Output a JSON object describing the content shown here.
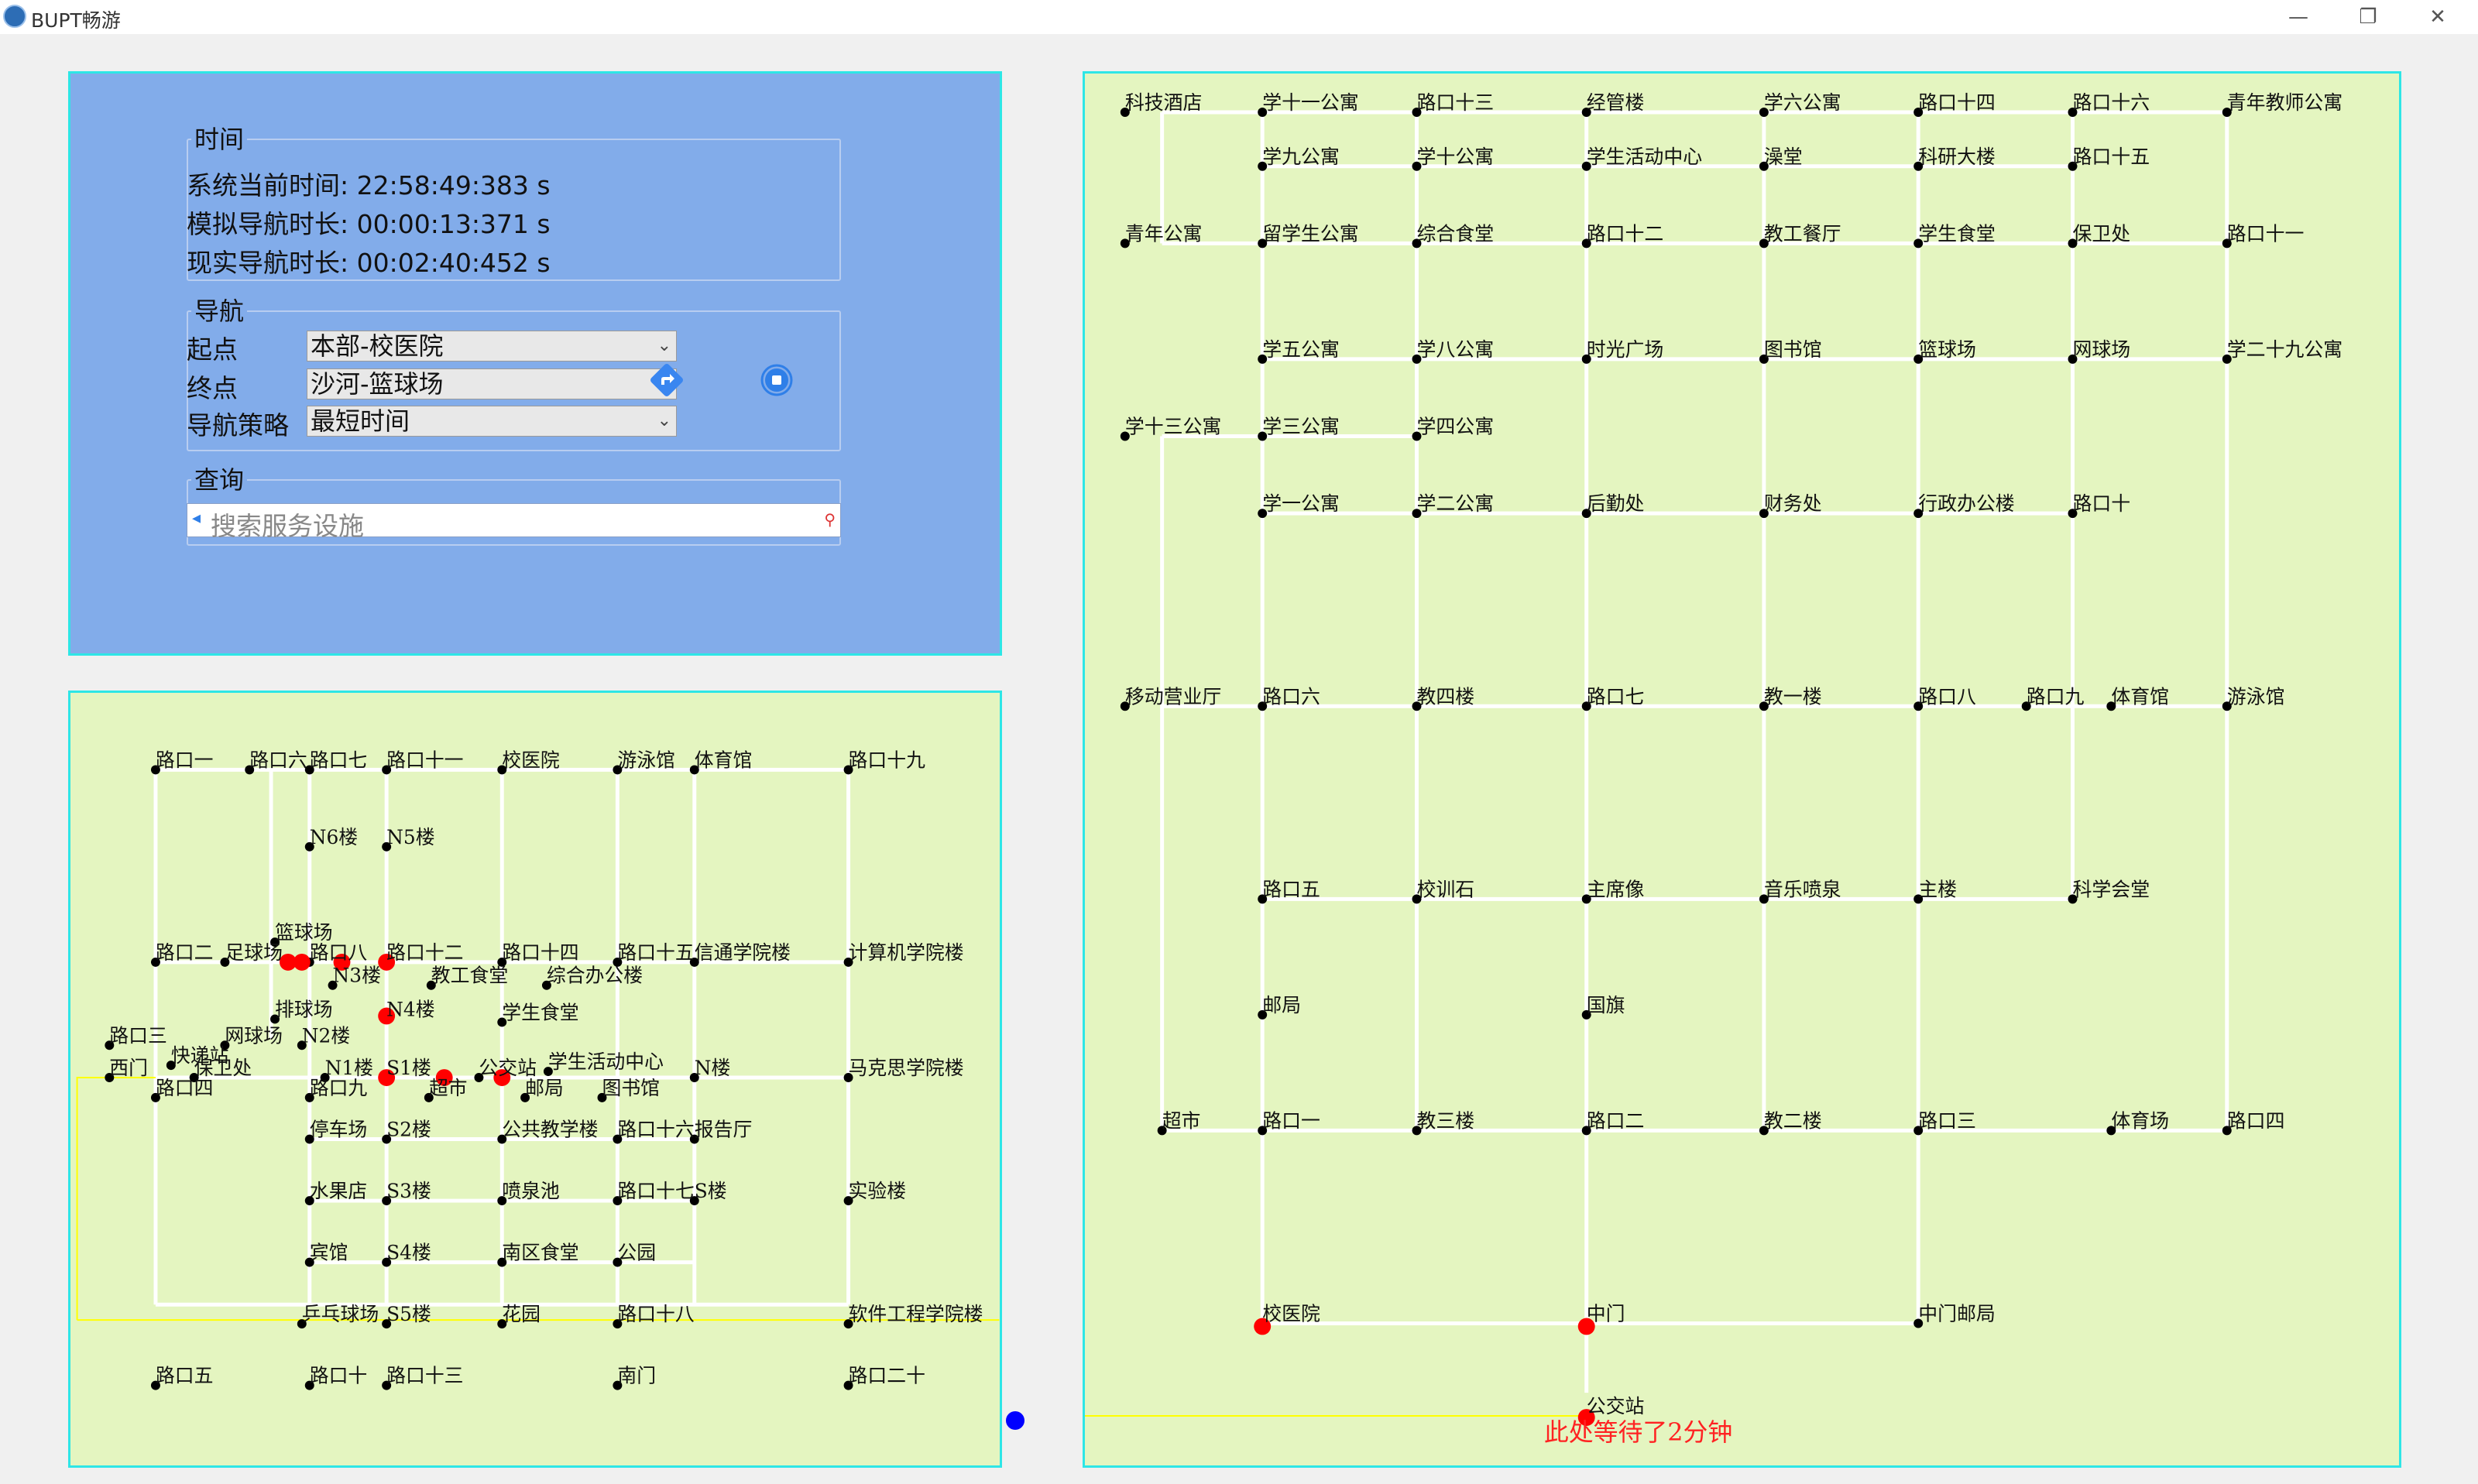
{
  "window": {
    "title": "BUPT畅游",
    "minimize_glyph": "—",
    "restore_glyph": "❐",
    "close_glyph": "✕"
  },
  "time_group": {
    "title": "时间",
    "system_time_label": "系统当前时间: 22:58:49:383 s",
    "sim_nav_label": "模拟导航时长: 00:00:13:371 s",
    "real_nav_label": "现实导航时长: 00:02:40:452 s"
  },
  "nav_group": {
    "title": "导航",
    "start_label": "起点",
    "start_value": "本部-校医院",
    "end_label": "终点",
    "end_value": "沙河-篮球场",
    "strategy_label": "导航策略",
    "strategy_value": "最短时间",
    "go_icon": "navigate-icon",
    "stop_icon": "stop-icon"
  },
  "query_group": {
    "title": "查询",
    "placeholder": "搜索服务设施"
  },
  "colors": {
    "panel_blue": "#82acea",
    "map_bg": "#e4f5c0",
    "road": "#ffffff",
    "path": "#ffff00",
    "path_node": "#ff0000",
    "current_pos": "#0000ff",
    "border": "#2ee6e6"
  },
  "left_map": {
    "labels": [
      "路口一",
      "路口六",
      "路口七",
      "路口十一",
      "校医院",
      "游泳馆",
      "体育馆",
      "路口十九",
      "N6楼",
      "N5楼",
      "篮球场",
      "路口二",
      "足球场",
      "路口八",
      "路口十二",
      "路口十四",
      "路口十五",
      "信通学院楼",
      "计算机学院楼",
      "N3楼",
      "教工食堂",
      "综合办公楼",
      "排球场",
      "N4楼",
      "学生食堂",
      "路口三",
      "网球场",
      "N2楼",
      "快递站",
      "西门",
      "保卫处",
      "N1楼",
      "S1楼",
      "公交站",
      "学生活动中心",
      "N楼",
      "马克思学院楼",
      "路口四",
      "路口九",
      "超市",
      "邮局",
      "图书馆",
      "停车场",
      "S2楼",
      "公共教学楼",
      "路口十六",
      "报告厅",
      "水果店",
      "S3楼",
      "喷泉池",
      "路口十七",
      "S楼",
      "实验楼",
      "宾馆",
      "S4楼",
      "南区食堂",
      "公园",
      "乒乓球场",
      "S5楼",
      "花园",
      "路口十八",
      "软件工程学院楼",
      "路口五",
      "路口十",
      "路口十三",
      "南门",
      "路口二十"
    ]
  },
  "right_map": {
    "labels": [
      "科技酒店",
      "学十一公寓",
      "路口十三",
      "经管楼",
      "学六公寓",
      "路口十四",
      "路口十六",
      "青年教师公寓",
      "学九公寓",
      "学十公寓",
      "学生活动中心",
      "澡堂",
      "科研大楼",
      "路口十五",
      "青年公寓",
      "留学生公寓",
      "综合食堂",
      "路口十二",
      "教工餐厅",
      "学生食堂",
      "保卫处",
      "路口十一",
      "学五公寓",
      "学八公寓",
      "时光广场",
      "图书馆",
      "篮球场",
      "网球场",
      "学二十九公寓",
      "学十三公寓",
      "学三公寓",
      "学四公寓",
      "学一公寓",
      "学二公寓",
      "后勤处",
      "财务处",
      "行政办公楼",
      "路口十",
      "移动营业厅",
      "路口六",
      "教四楼",
      "路口七",
      "教一楼",
      "路口八",
      "路口九",
      "体育馆",
      "游泳馆",
      "路口五",
      "校训石",
      "主席像",
      "音乐喷泉",
      "主楼",
      "科学会堂",
      "邮局",
      "国旗",
      "超市",
      "路口一",
      "教三楼",
      "路口二",
      "教二楼",
      "路口三",
      "体育场",
      "路口四",
      "校医院",
      "中门",
      "中门邮局",
      "公交站"
    ],
    "wait_message": "此处等待了2分钟"
  }
}
